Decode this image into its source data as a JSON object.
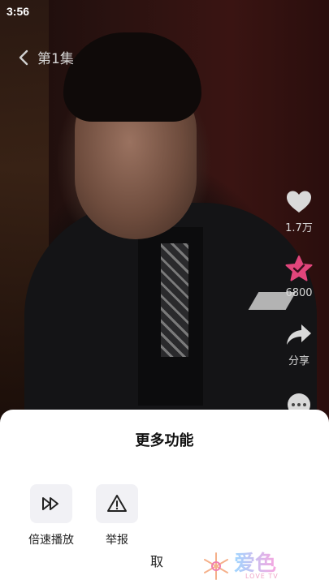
{
  "status": {
    "time": "3:56"
  },
  "header": {
    "episode": "第1集"
  },
  "rail": {
    "like_count": "1.7万",
    "favorite_count": "6800",
    "share_label": "分享"
  },
  "sheet": {
    "title": "更多功能",
    "actions": [
      {
        "label": "倍速播放",
        "icon": "fast-forward-icon"
      },
      {
        "label": "举报",
        "icon": "warning-icon"
      }
    ],
    "cancel_label": "取"
  },
  "watermark": {
    "brand": "爱色",
    "sub": "LOVE TV"
  },
  "colors": {
    "favorite": "#e0457b",
    "sheet_bg": "#ffffff",
    "action_bg": "#f1f1f5"
  }
}
